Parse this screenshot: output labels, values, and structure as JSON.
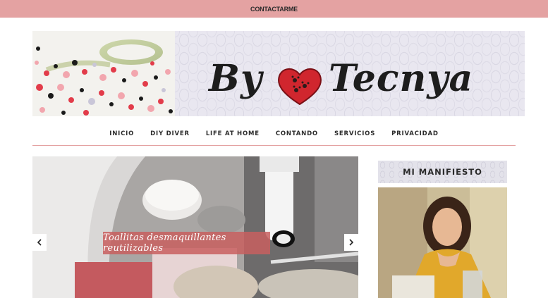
{
  "topbar": {
    "contact_label": "CONTACTARME"
  },
  "header": {
    "brand_prefix": "By",
    "brand_name": "Tecnya",
    "brand_colors": {
      "heart": "#d0262e",
      "paws": "#2a1a1a"
    }
  },
  "nav": {
    "items": [
      {
        "label": "INICIO"
      },
      {
        "label": "DIY DIVER"
      },
      {
        "label": "LIFE AT HOME"
      },
      {
        "label": "CONTANDO"
      },
      {
        "label": "SERVICIOS"
      },
      {
        "label": "PRIVACIDAD"
      }
    ]
  },
  "slider": {
    "caption": "Toallitas desmaquillantes reutilizables",
    "prev_icon": "chevron-left-icon",
    "next_icon": "chevron-right-icon"
  },
  "sidebar": {
    "widget_title": "MI MANIFIESTO"
  },
  "colors": {
    "accent": "#e4a2a2",
    "text": "#2b2b2b"
  }
}
